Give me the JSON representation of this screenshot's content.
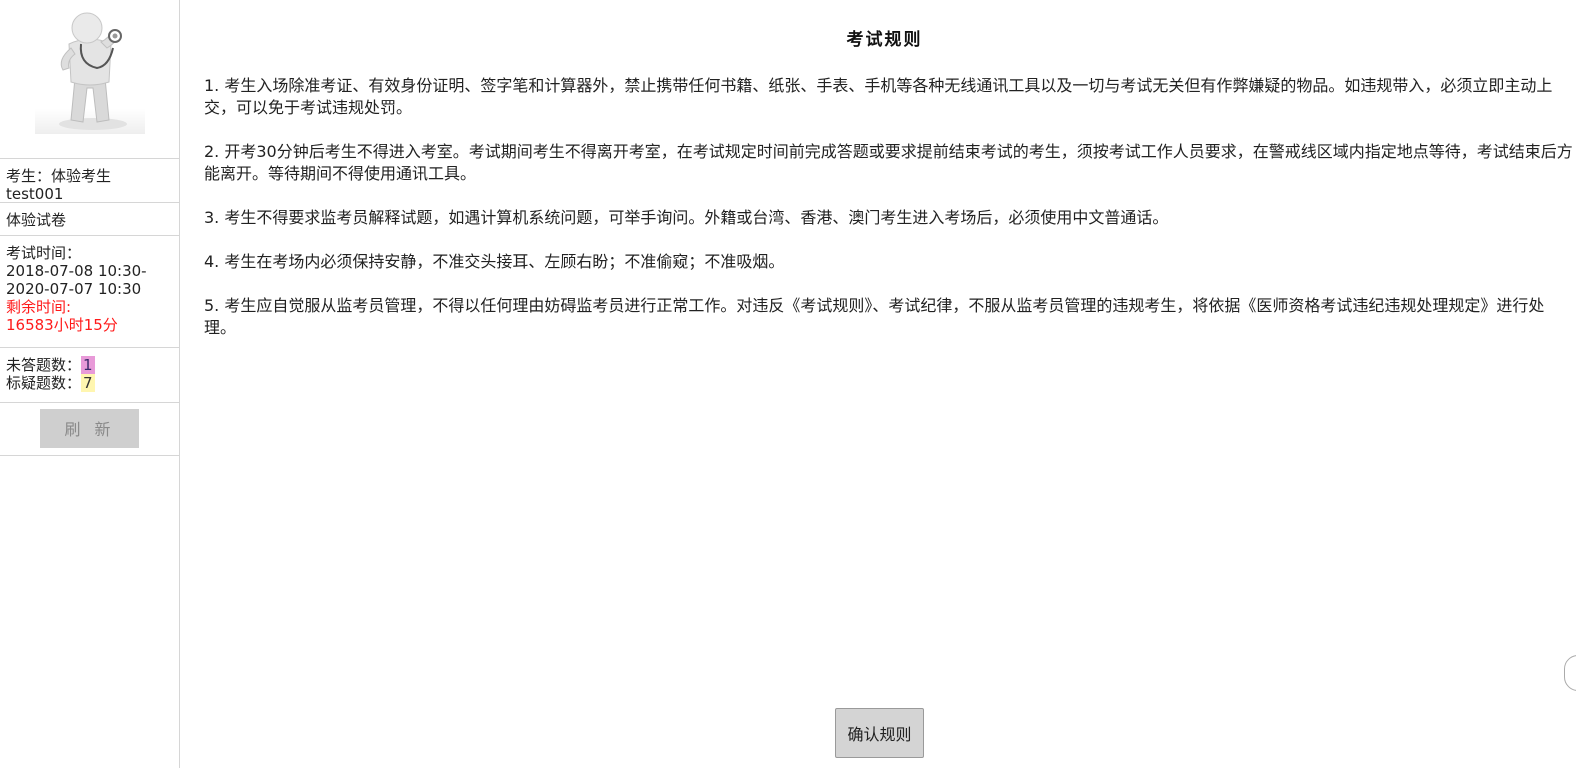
{
  "sidebar": {
    "avatar_icon": "doctor-figure-icon",
    "candidate_label": "考生：体验考生",
    "candidate_id": "test001",
    "paper_name": "体验试卷",
    "exam_time_label": "考试时间：",
    "exam_time_range_start": "2018-07-08 10:30-",
    "exam_time_range_end": "2020-07-07 10:30",
    "remaining_label": "剩余时间:",
    "remaining_value": "16583小时15分",
    "unanswered_label": "未答题数：",
    "unanswered_value": "1",
    "flagged_label": "标疑题数：",
    "flagged_value": "7",
    "refresh_label": "刷新"
  },
  "main": {
    "title": "考试规则",
    "rules": [
      "1. 考生入场除准考证、有效身份证明、签字笔和计算器外，禁止携带任何书籍、纸张、手表、手机等各种无线通讯工具以及一切与考试无关但有作弊嫌疑的物品。如违规带入，必须立即主动上交，可以免于考试违规处罚。",
      "2. 开考30分钟后考生不得进入考室。考试期间考生不得离开考室，在考试规定时间前完成答题或要求提前结束考试的考生，须按考试工作人员要求，在警戒线区域内指定地点等待，考试结束后方能离开。等待期间不得使用通讯工具。",
      "3. 考生不得要求监考员解释试题，如遇计算机系统问题，可举手询问。外籍或台湾、香港、澳门考生进入考场后，必须使用中文普通话。",
      "4. 考生在考场内必须保持安静，不准交头接耳、左顾右盼；不准偷窥；不准吸烟。",
      "5. 考生应自觉服从监考员管理，不得以任何理由妨碍监考员进行正常工作。对违反《考试规则》、考试纪律，不服从监考员管理的违规考生，将依据《医师资格考试违纪违规处理规定》进行处理。"
    ],
    "confirm_label": "确认规则"
  },
  "colors": {
    "remaining_text": "#ff1a1a",
    "unanswered_highlight": "#e89ad8",
    "flagged_highlight": "#fff6b0",
    "button_bg": "#d4d4d4"
  }
}
